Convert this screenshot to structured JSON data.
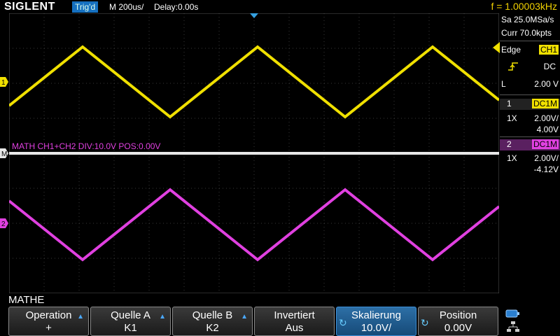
{
  "topbar": {
    "logo": "SIGLENT",
    "trigger_status": "Trig'd",
    "timebase": "M 200us/",
    "delay": "Delay:0.00s",
    "frequency": "f = 1.00003kHz"
  },
  "acquisition": {
    "sample_rate": "Sa 25.0MSa/s",
    "memory": "Curr 70.0kpts"
  },
  "trigger": {
    "type": "Edge",
    "source": "CH1",
    "coupling": "DC",
    "level_label": "L",
    "level": "2.00 V"
  },
  "channels": [
    {
      "number": "1",
      "coupling": "DC1M",
      "probe": "1X",
      "scale": "2.00V/",
      "offset": "4.00V",
      "color": "#f0e000"
    },
    {
      "number": "2",
      "coupling": "DC1M",
      "probe": "1X",
      "scale": "2.00V/",
      "offset": "-4.12V",
      "color": "#e040e0"
    }
  ],
  "math": {
    "label": "MATH  CH1+CH2  DIV:10.0V  POS:0.00V",
    "color": "#e040e0",
    "trace_color": "#e8e8e8"
  },
  "markers": {
    "ch1": "1",
    "ch2": "2"
  },
  "menu": {
    "title": "MATHE",
    "keys": [
      {
        "line1": "Operation",
        "line2": "+"
      },
      {
        "line1": "Quelle A",
        "line2": "K1"
      },
      {
        "line1": "Quelle B",
        "line2": "K2"
      },
      {
        "line1": "Invertiert",
        "line2": "Aus"
      },
      {
        "line1": "Skalierung",
        "line2": "10.0V/"
      },
      {
        "line1": "Position",
        "line2": "0.00V"
      }
    ]
  }
}
